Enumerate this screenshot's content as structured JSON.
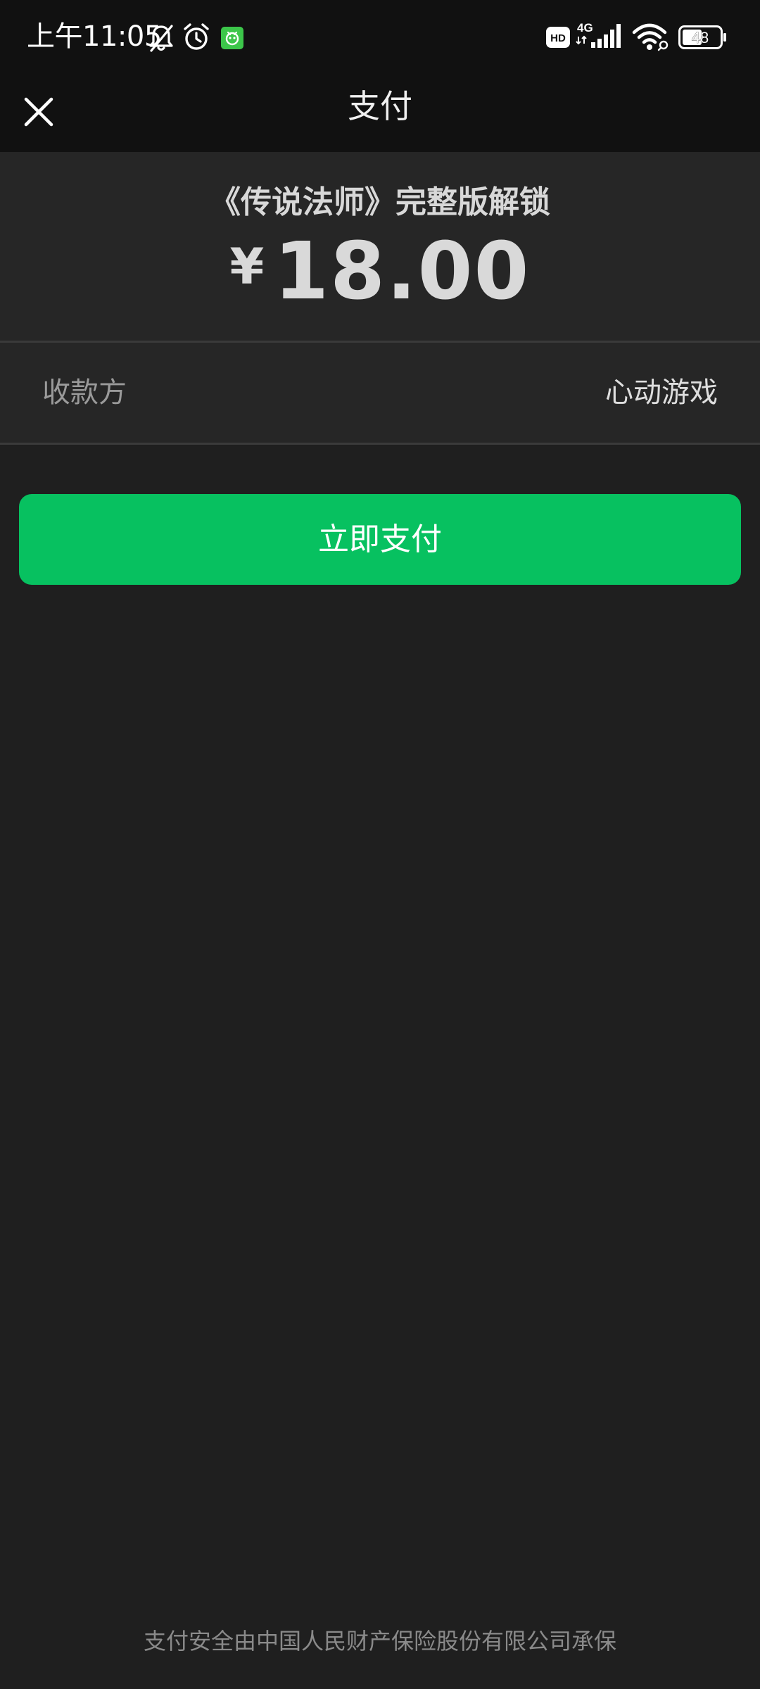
{
  "status_bar": {
    "time": "上午11:05",
    "icons": [
      "bell-off-icon",
      "alarm-icon",
      "app-notification-icon",
      "hd-icon",
      "signal-4g-icon",
      "wifi-icon",
      "battery-icon"
    ],
    "network_label": "4G",
    "hd_label": "HD",
    "battery_level": "48"
  },
  "nav": {
    "close_icon": "close-icon",
    "title": "支付"
  },
  "order": {
    "product_name": "《传说法师》完整版解锁",
    "currency_symbol": "¥",
    "amount": "18.00"
  },
  "payee": {
    "label": "收款方",
    "value": "心动游戏"
  },
  "actions": {
    "pay_label": "立即支付"
  },
  "footer": {
    "note": "支付安全由中国人民财产保险股份有限公司承保"
  },
  "colors": {
    "background": "#1f1f1f",
    "top_bar": "#111111",
    "card": "#262626",
    "accent_green": "#07c160",
    "app_badge_green": "#3cc64a"
  }
}
